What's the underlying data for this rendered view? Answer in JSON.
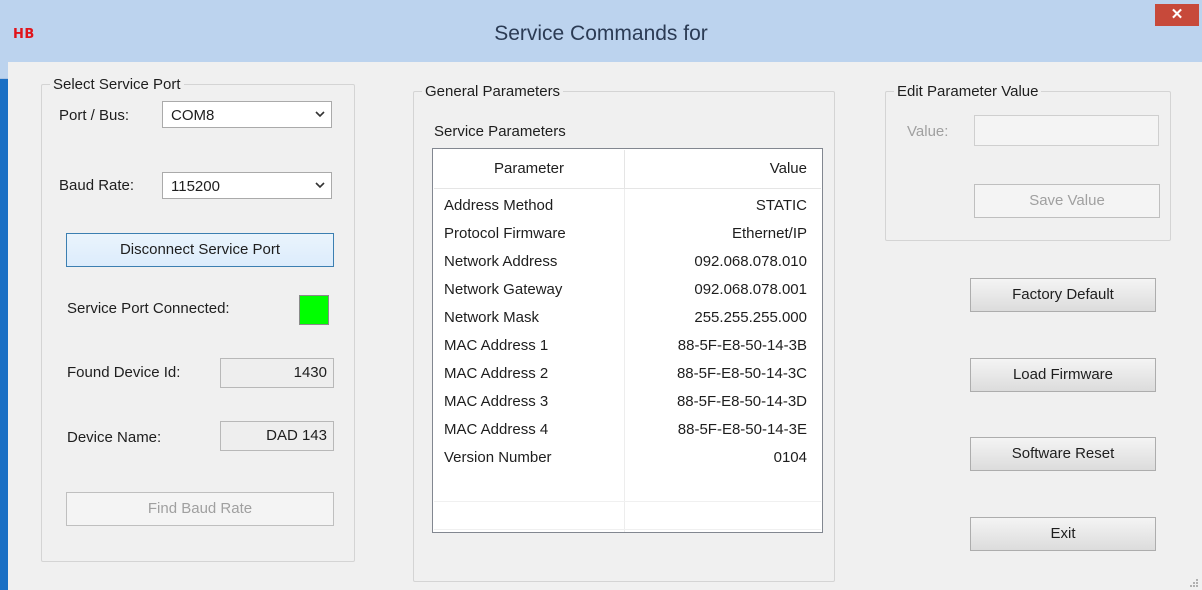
{
  "window": {
    "logo": "HB",
    "title": "Service Commands for",
    "close_glyph": "✕"
  },
  "service_port": {
    "legend": "Select Service Port",
    "port_label": "Port / Bus:",
    "port_value": "COM8",
    "baud_label": "Baud Rate:",
    "baud_value": "115200",
    "disconnect_button": "Disconnect Service Port",
    "connected_label": "Service Port Connected:",
    "connected_color": "#00ff00",
    "device_id_label": "Found Device Id:",
    "device_id_value": "1430",
    "device_name_label": "Device Name:",
    "device_name_value": "DAD 143",
    "find_baud_button": "Find Baud Rate"
  },
  "general": {
    "legend": "General Parameters",
    "list_title": "Service Parameters",
    "columns": [
      "Parameter",
      "Value"
    ],
    "rows": [
      {
        "parameter": "Address Method",
        "value": "STATIC"
      },
      {
        "parameter": "Protocol Firmware",
        "value": "Ethernet/IP"
      },
      {
        "parameter": "Network Address",
        "value": "092.068.078.010"
      },
      {
        "parameter": "Network Gateway",
        "value": "092.068.078.001"
      },
      {
        "parameter": "Network Mask",
        "value": "255.255.255.000"
      },
      {
        "parameter": "MAC Address 1",
        "value": "88-5F-E8-50-14-3B"
      },
      {
        "parameter": "MAC Address 2",
        "value": "88-5F-E8-50-14-3C"
      },
      {
        "parameter": "MAC Address 3",
        "value": "88-5F-E8-50-14-3D"
      },
      {
        "parameter": "MAC Address 4",
        "value": "88-5F-E8-50-14-3E"
      },
      {
        "parameter": "Version Number",
        "value": "0104"
      }
    ]
  },
  "edit": {
    "legend": "Edit Parameter Value",
    "value_label": "Value:",
    "value_text": "",
    "save_button": "Save Value"
  },
  "actions": {
    "factory_default": "Factory Default",
    "load_firmware": "Load Firmware",
    "software_reset": "Software Reset",
    "exit": "Exit"
  },
  "colors": {
    "title_bar": "#bcd3ee",
    "close_button": "#c7493a",
    "logo": "#e0141b",
    "window_border": "#1a6fc4"
  },
  "icons": {
    "close": "close-icon",
    "dropdown": "chevron-down-icon",
    "resize": "resize-grip-icon"
  }
}
